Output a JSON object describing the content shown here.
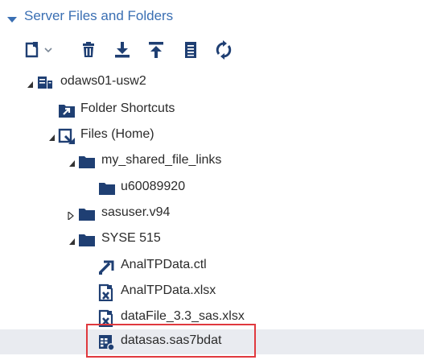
{
  "panel": {
    "title": "Server Files and Folders"
  },
  "toolbar": {
    "buttons": [
      {
        "name": "new-menu-button",
        "icon": "new-file-icon"
      },
      {
        "name": "delete-button",
        "icon": "trash-icon"
      },
      {
        "name": "download-button",
        "icon": "download-icon"
      },
      {
        "name": "upload-button",
        "icon": "upload-icon"
      },
      {
        "name": "properties-button",
        "icon": "properties-icon"
      },
      {
        "name": "refresh-button",
        "icon": "refresh-icon"
      }
    ]
  },
  "tree": {
    "nodes": [
      {
        "label": "odaws01-usw2",
        "icon": "server-icon",
        "expanded": true
      },
      {
        "label": "Folder Shortcuts",
        "icon": "folder-shortcut-icon"
      },
      {
        "label": "Files (Home)",
        "icon": "home-files-icon",
        "expanded": true
      },
      {
        "label": "my_shared_file_links",
        "icon": "folder-icon",
        "expanded": true
      },
      {
        "label": "u60089920",
        "icon": "folder-icon"
      },
      {
        "label": "sasuser.v94",
        "icon": "folder-icon",
        "expanded": false
      },
      {
        "label": "SYSE 515",
        "icon": "folder-icon",
        "expanded": true
      },
      {
        "label": "AnalTPData.ctl",
        "icon": "ctl-file-icon"
      },
      {
        "label": "AnalTPData.xlsx",
        "icon": "excel-file-icon"
      },
      {
        "label": "dataFile_3.3_sas.xlsx",
        "icon": "excel-file-icon"
      },
      {
        "label": "datasas.sas7bdat",
        "icon": "sas-dataset-icon",
        "selected": true
      }
    ]
  },
  "colors": {
    "accent": "#3a6fb3",
    "icon": "#1f3f73",
    "selection_bg": "#e9ebf0",
    "highlight_border": "#e0393e"
  }
}
